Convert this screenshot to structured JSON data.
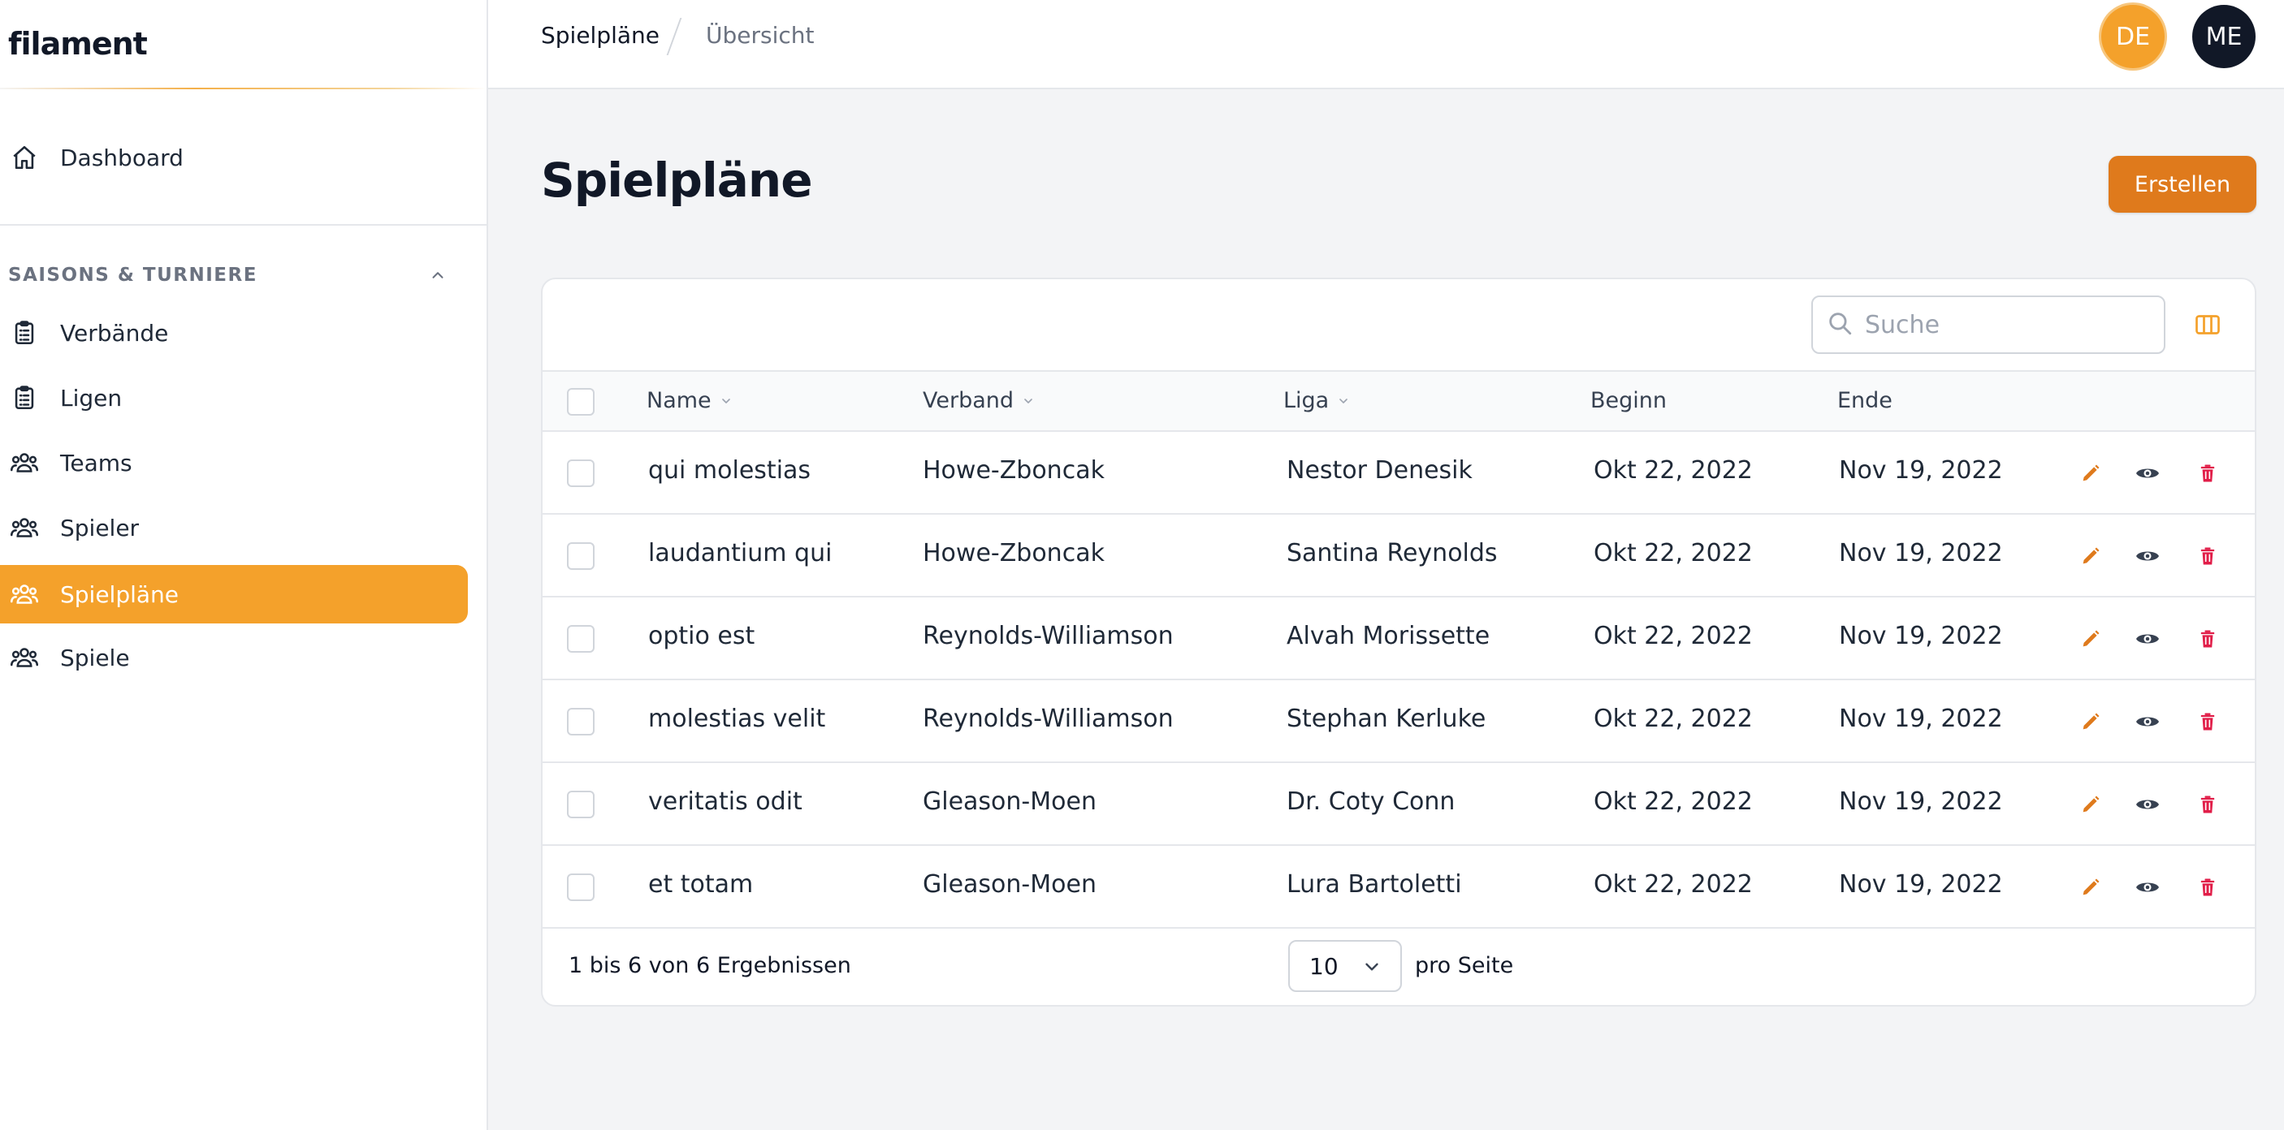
{
  "brand": "filament",
  "sidebar": {
    "dashboard": "Dashboard",
    "group_label": "SAISONS & TURNIERE",
    "items": [
      {
        "label": "Verbände",
        "icon": "clipboard-icon"
      },
      {
        "label": "Ligen",
        "icon": "clipboard-icon"
      },
      {
        "label": "Teams",
        "icon": "users-icon"
      },
      {
        "label": "Spieler",
        "icon": "users-icon"
      },
      {
        "label": "Spielpläne",
        "icon": "users-icon",
        "active": true
      },
      {
        "label": "Spiele",
        "icon": "users-icon"
      }
    ]
  },
  "topbar": {
    "breadcrumb": [
      "Spielpläne",
      "Übersicht"
    ],
    "avatars": [
      "DE",
      "ME"
    ]
  },
  "page": {
    "title": "Spielpläne",
    "create_label": "Erstellen"
  },
  "table": {
    "search_placeholder": "Suche",
    "columns": [
      "Name",
      "Verband",
      "Liga",
      "Beginn",
      "Ende"
    ],
    "rows": [
      [
        "qui molestias",
        "Howe-Zboncak",
        "Nestor Denesik",
        "Okt 22, 2022",
        "Nov 19, 2022"
      ],
      [
        "laudantium qui",
        "Howe-Zboncak",
        "Santina Reynolds",
        "Okt 22, 2022",
        "Nov 19, 2022"
      ],
      [
        "optio est",
        "Reynolds-Williamson",
        "Alvah Morissette",
        "Okt 22, 2022",
        "Nov 19, 2022"
      ],
      [
        "molestias velit",
        "Reynolds-Williamson",
        "Stephan Kerluke",
        "Okt 22, 2022",
        "Nov 19, 2022"
      ],
      [
        "veritatis odit",
        "Gleason-Moen",
        "Dr. Coty Conn",
        "Okt 22, 2022",
        "Nov 19, 2022"
      ],
      [
        "et totam",
        "Gleason-Moen",
        "Lura Bartoletti",
        "Okt 22, 2022",
        "Nov 19, 2022"
      ]
    ],
    "pagination_text": "1 bis 6 von 6 Ergebnissen",
    "per_page_value": "10",
    "per_page_label": "pro Seite"
  },
  "colors": {
    "accent": "#f4a12b",
    "button": "#df7a1c",
    "danger": "#e11d48"
  }
}
